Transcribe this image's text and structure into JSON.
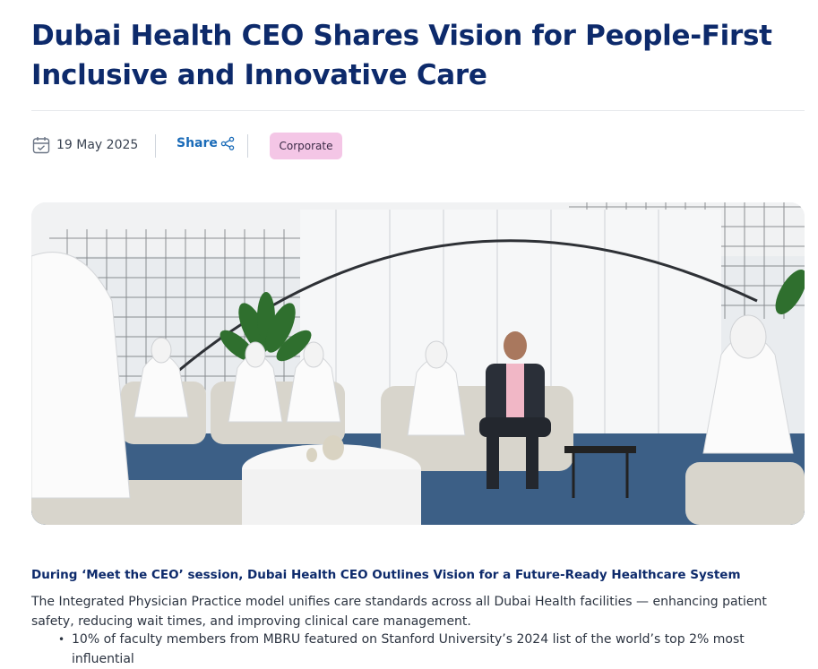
{
  "article": {
    "title": "Dubai Health CEO Shares Vision for People-First Inclusive and Innovative Care",
    "date": "19 May 2025",
    "share_label": "Share",
    "category_tag": "Corporate",
    "hero_image_label": "photo",
    "subheading": "During ‘Meet the CEO’ session, Dubai Health CEO Outlines Vision for a Future-Ready Healthcare System",
    "paragraph": "The Integrated Physician Practice model unifies care standards across all Dubai Health facilities — enhancing patient safety, reducing wait times, and improving clinical care management.",
    "bullets": [
      "10% of faculty members from MBRU featured on Stanford University’s 2024 list of the world’s top 2% most influential"
    ]
  },
  "colors": {
    "title": "#0d2a6b",
    "link": "#1a6bb8",
    "tag_bg": "#f4c6e6"
  },
  "icons": {
    "date": "calendar-icon",
    "share": "share-icon"
  }
}
